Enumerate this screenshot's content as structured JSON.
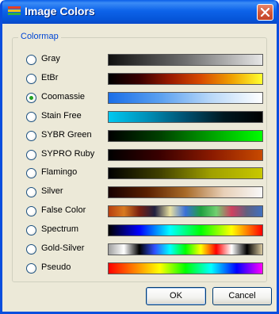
{
  "window": {
    "title": "Image Colors",
    "close_icon": "close-icon",
    "app_icon": "colormap-icon"
  },
  "group": {
    "label": "Colormap"
  },
  "colormaps": [
    {
      "label": "Gray",
      "selected": false,
      "stops": [
        "#101010",
        "#6e6e6e",
        "#e6e6e6"
      ]
    },
    {
      "label": "EtBr",
      "selected": false,
      "stops": [
        "#000000",
        "#3a0000",
        "#9a1a00",
        "#d84a00",
        "#f0a000",
        "#ffff30"
      ]
    },
    {
      "label": "Coomassie",
      "selected": true,
      "stops": [
        "#1a6ee8",
        "#5aa0f0",
        "#b9d8f8",
        "#ffffff"
      ]
    },
    {
      "label": "Stain Free",
      "selected": false,
      "stops": [
        "#00c8f0",
        "#0090b8",
        "#005070",
        "#001820",
        "#000000"
      ]
    },
    {
      "label": "SYBR Green",
      "selected": false,
      "stops": [
        "#000000",
        "#004000",
        "#00a000",
        "#00ff00"
      ]
    },
    {
      "label": "SYPRO Ruby",
      "selected": false,
      "stops": [
        "#000000",
        "#3a0000",
        "#8a1a00",
        "#c84a00"
      ]
    },
    {
      "label": "Flamingo",
      "selected": false,
      "stops": [
        "#000000",
        "#404000",
        "#a0a000",
        "#c8c800"
      ]
    },
    {
      "label": "Silver",
      "selected": false,
      "stops": [
        "#180000",
        "#5a2000",
        "#a86a28",
        "#e8d0b8",
        "#f8f8f8"
      ]
    },
    {
      "label": "False Color",
      "selected": false,
      "stops": [
        "#b84010",
        "#d87a20",
        "#7a2010",
        "#202040",
        "#e8e0a0",
        "#3a70d8",
        "#20a040",
        "#70d070",
        "#d04060",
        "#606080",
        "#4070c0"
      ]
    },
    {
      "label": "Spectrum",
      "selected": false,
      "stops": [
        "#000000",
        "#0000ff",
        "#00ffff",
        "#00ff00",
        "#ffff00",
        "#ff0000"
      ]
    },
    {
      "label": "Gold-Silver",
      "selected": false,
      "stops": [
        "#a0a0a0",
        "#ffffff",
        "#000000",
        "#3050ff",
        "#00ffff",
        "#00ff00",
        "#ffff00",
        "#ff0000",
        "#ffffff",
        "#000000",
        "#d8c8a0"
      ]
    },
    {
      "label": "Pseudo",
      "selected": false,
      "stops": [
        "#ff0000",
        "#ff8000",
        "#ffff00",
        "#00ff00",
        "#00ffff",
        "#0000ff",
        "#ff00ff"
      ]
    }
  ],
  "buttons": {
    "ok": "OK",
    "cancel": "Cancel"
  }
}
